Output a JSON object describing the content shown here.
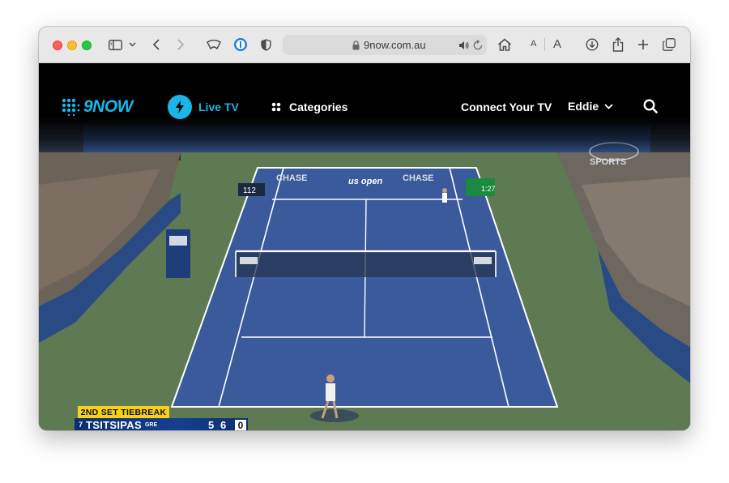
{
  "browser": {
    "url": "9now.com.au",
    "font_small_label": "A",
    "font_large_label": "A"
  },
  "nav": {
    "logo_text": "9NOW",
    "live_tv_label": "Live TV",
    "categories_label": "Categories",
    "connect_label": "Connect Your TV",
    "user_name": "Eddie"
  },
  "broadcast": {
    "court_board_left": "112",
    "court_board_right": "1:27",
    "sponsor_1": "CHASE",
    "sponsor_2": "us open",
    "sponsor_3": "CHASE",
    "watermark": "SPORTS"
  },
  "scoreboard": {
    "banner": "2ND SET TIEBREAK",
    "seed": "7",
    "player": "TSITSIPAS",
    "country": "GRE",
    "set1": "5",
    "set2": "6",
    "game": "0"
  },
  "colors": {
    "brand": "#19b6e8",
    "court": "#3a5a9c",
    "surround": "#5e7a52",
    "tiebreak": "#f7d117"
  },
  "icons": [
    "sidebar-icon",
    "chevron-down-icon",
    "back-icon",
    "forward-icon",
    "ublock-icon",
    "onepassword-icon",
    "shield-icon",
    "lock-icon",
    "speaker-icon",
    "reload-icon",
    "home-icon",
    "download-icon",
    "share-icon",
    "new-tab-icon",
    "tab-overview-icon",
    "lightning-icon",
    "grid-icon",
    "search-icon"
  ]
}
